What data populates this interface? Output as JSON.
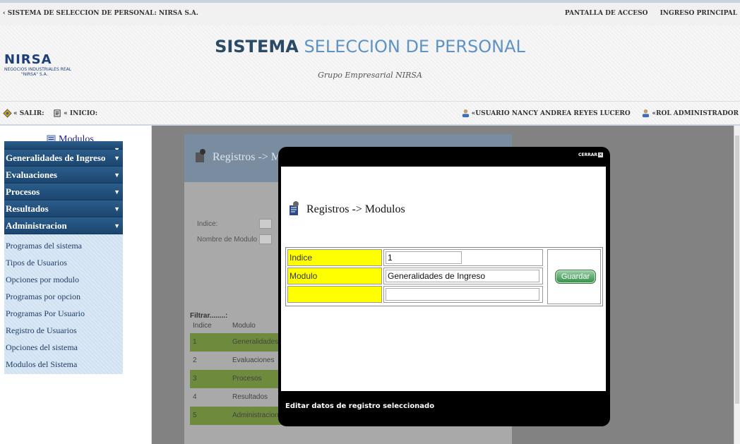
{
  "topbar": {
    "system_label": "‹ SISTEMA DE SELECCION DE PERSONAL: NIRSA S.A.",
    "access_link": "PANTALLA DE ACCESO",
    "home_link": "INGRESO PRINCIPAL"
  },
  "banner": {
    "logo_mark": "NIRSA",
    "logo_sub": "NEGOCIOS INDUSTRIALES REAL",
    "logo_sub2": "\"NIRSA\" S.A.",
    "title_dark": "SISTEMA",
    "title_light": " SELECCION DE PERSONAL",
    "subtitle": "Grupo Empresarial NIRSA"
  },
  "userbar": {
    "salir": "« SALIR:",
    "inicio": "« INICIO:",
    "usuario": "«USUARIO NANCY ANDREA REYES LUCERO",
    "rol": "«ROL ADMINISTRADOR"
  },
  "sidebar": {
    "title": "Modulos",
    "menus": [
      {
        "label": "Generalidades de Ingreso"
      },
      {
        "label": "Evaluaciones"
      },
      {
        "label": "Procesos"
      },
      {
        "label": "Resultados"
      },
      {
        "label": "Administracion"
      }
    ],
    "admin_items": [
      "Programas del sistema",
      "Tipos de Usuarios",
      "Opciones por modulo",
      "Programas por opcion",
      "Programas Por Usuario",
      "Registro de Usuarios",
      "Opciones del sistema",
      "Modulos del Sistema"
    ]
  },
  "background_panel": {
    "title": "Registros -> Modulos del sistema",
    "indice_label": "Indice:",
    "nombre_label": "Nombre de Modulo",
    "filtrar": "Filtrar........:",
    "col_indice": "Indice",
    "col_modulo": "Modulo",
    "rows": [
      {
        "indice": "1",
        "modulo": "Generalidades de Ingreso"
      },
      {
        "indice": "2",
        "modulo": "Evaluaciones"
      },
      {
        "indice": "3",
        "modulo": "Procesos"
      },
      {
        "indice": "4",
        "modulo": "Resultados"
      },
      {
        "indice": "5",
        "modulo": "Administracion"
      }
    ]
  },
  "modal": {
    "close_label": "CERRAR",
    "title": "Registros -> Modulos",
    "fields": {
      "indice_label": "Indice",
      "indice_value": "1",
      "modulo_label": "Modulo",
      "modulo_value": "Generalidades de Ingreso",
      "extra_label": "",
      "extra_value": ""
    },
    "save_label": "Guardar",
    "footer": "Editar datos de registro seleccionado"
  }
}
